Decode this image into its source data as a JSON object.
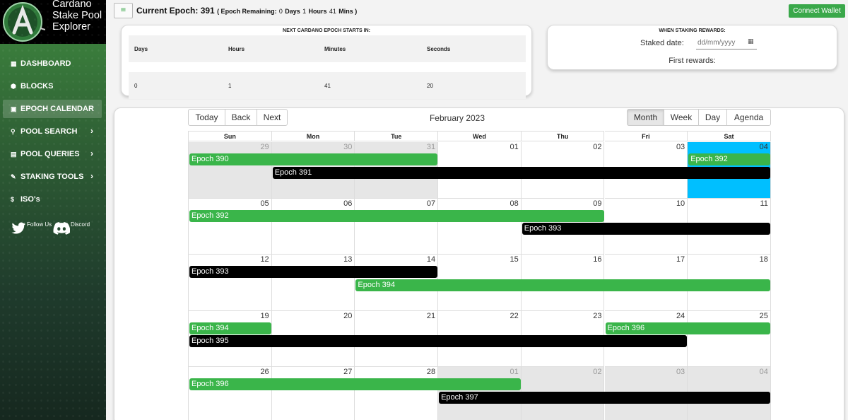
{
  "brand": {
    "title_line1": "Cardano",
    "title_line2": "Stake Pool",
    "title_line3": "Explorer"
  },
  "sidebar": {
    "items": [
      {
        "label": "DASHBOARD",
        "icon": "grid-icon",
        "chevron": false,
        "active": false
      },
      {
        "label": "BLOCKS",
        "icon": "cube-icon",
        "chevron": false,
        "active": false
      },
      {
        "label": "EPOCH CALENDAR",
        "icon": "calendar-icon",
        "chevron": false,
        "active": true
      },
      {
        "label": "POOL SEARCH",
        "icon": "search-icon",
        "chevron": true,
        "active": false
      },
      {
        "label": "POOL QUERIES",
        "icon": "document-icon",
        "chevron": true,
        "active": false
      },
      {
        "label": "STAKING TOOLS",
        "icon": "wrench-icon",
        "chevron": true,
        "active": false
      },
      {
        "label": "ISO's",
        "icon": "dollar-icon",
        "chevron": false,
        "active": false
      }
    ],
    "social": {
      "twitter_label": "Follow Us",
      "discord_label": "Discord"
    }
  },
  "header": {
    "current_epoch_label": "Current Epoch:",
    "current_epoch_value": "391",
    "remaining_label": "( Epoch Remaining:",
    "remaining_days": "0",
    "days_label": "Days",
    "remaining_hours": "1",
    "hours_label": "Hours",
    "remaining_mins": "41",
    "mins_label": "Mins )",
    "connect_wallet": "Connect Wallet"
  },
  "next_epoch": {
    "title": "NEXT CARDANO EPOCH STARTS IN:",
    "columns": [
      "Days",
      "Hours",
      "Minutes",
      "Seconds"
    ],
    "values": [
      "0",
      "1",
      "41",
      "20"
    ]
  },
  "rewards": {
    "title": "WHEN STAKING REWARDS:",
    "staked_date_label": "Staked date:",
    "staked_date_placeholder": "dd/mm/yyyy",
    "first_rewards_label": "First rewards:"
  },
  "calendar": {
    "nav": {
      "today": "Today",
      "back": "Back",
      "next": "Next"
    },
    "label": "February 2023",
    "views": [
      "Month",
      "Week",
      "Day",
      "Agenda"
    ],
    "active_view": "Month",
    "weekdays": [
      "Sun",
      "Mon",
      "Tue",
      "Wed",
      "Thu",
      "Fri",
      "Sat"
    ],
    "weeks": [
      [
        {
          "d": "29",
          "off": true
        },
        {
          "d": "30",
          "off": true
        },
        {
          "d": "31",
          "off": true
        },
        {
          "d": "01"
        },
        {
          "d": "02"
        },
        {
          "d": "03"
        },
        {
          "d": "04",
          "today": true
        }
      ],
      [
        {
          "d": "05"
        },
        {
          "d": "06"
        },
        {
          "d": "07"
        },
        {
          "d": "08"
        },
        {
          "d": "09"
        },
        {
          "d": "10"
        },
        {
          "d": "11"
        }
      ],
      [
        {
          "d": "12"
        },
        {
          "d": "13"
        },
        {
          "d": "14"
        },
        {
          "d": "15"
        },
        {
          "d": "16"
        },
        {
          "d": "17"
        },
        {
          "d": "18"
        }
      ],
      [
        {
          "d": "19"
        },
        {
          "d": "20"
        },
        {
          "d": "21"
        },
        {
          "d": "22"
        },
        {
          "d": "23"
        },
        {
          "d": "24"
        },
        {
          "d": "25"
        }
      ],
      [
        {
          "d": "26"
        },
        {
          "d": "27"
        },
        {
          "d": "28"
        },
        {
          "d": "01",
          "off": true
        },
        {
          "d": "02",
          "off": true
        },
        {
          "d": "03",
          "off": true
        },
        {
          "d": "04",
          "off": true
        }
      ]
    ],
    "events": [
      {
        "label": "Epoch 390",
        "color": "green",
        "week": 0,
        "start": 0,
        "end": 2,
        "lane": 0
      },
      {
        "label": "Epoch 392",
        "color": "green",
        "week": 0,
        "start": 6,
        "end": 6,
        "lane": 0
      },
      {
        "label": "Epoch 391",
        "color": "black",
        "week": 0,
        "start": 1,
        "end": 6,
        "lane": 1
      },
      {
        "label": "Epoch 392",
        "color": "green",
        "week": 1,
        "start": 0,
        "end": 4,
        "lane": 0
      },
      {
        "label": "Epoch 393",
        "color": "black",
        "week": 1,
        "start": 4,
        "end": 6,
        "lane": 1
      },
      {
        "label": "Epoch 393",
        "color": "black",
        "week": 2,
        "start": 0,
        "end": 2,
        "lane": 0
      },
      {
        "label": "Epoch 394",
        "color": "green",
        "week": 2,
        "start": 2,
        "end": 6,
        "lane": 1
      },
      {
        "label": "Epoch 394",
        "color": "green",
        "week": 3,
        "start": 0,
        "end": 0,
        "lane": 0
      },
      {
        "label": "Epoch 396",
        "color": "green",
        "week": 3,
        "start": 5,
        "end": 6,
        "lane": 0
      },
      {
        "label": "Epoch 395",
        "color": "black",
        "week": 3,
        "start": 0,
        "end": 5,
        "lane": 1
      },
      {
        "label": "Epoch 396",
        "color": "green",
        "week": 4,
        "start": 0,
        "end": 3,
        "lane": 0
      },
      {
        "label": "Epoch 397",
        "color": "black",
        "week": 4,
        "start": 3,
        "end": 6,
        "lane": 1
      }
    ]
  }
}
